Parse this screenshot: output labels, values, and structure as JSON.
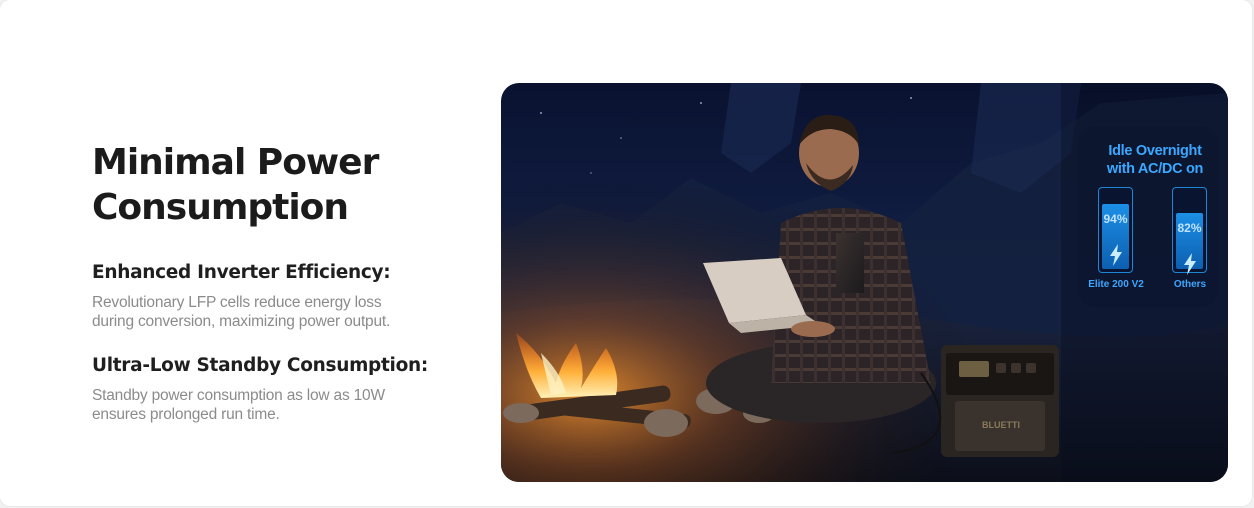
{
  "heading": {
    "line1": "Minimal Power",
    "line2": "Consumption"
  },
  "features": [
    {
      "title": "Enhanced Inverter Efficiency:",
      "line1": "Revolutionary LFP cells reduce energy loss",
      "line2": "during conversion, maximizing power output."
    },
    {
      "title": "Ultra-Low Standby Consumption:",
      "line1": "Standby power consumption as low as 10W",
      "line2": "ensures prolonged run time."
    }
  ],
  "comparison": {
    "title_line1": "Idle Overnight",
    "title_line2": "with AC/DC on",
    "accent_color": "#3aa8ff",
    "items": [
      {
        "percent": "94%",
        "level": 0.94,
        "label": "Elite 200 V2"
      },
      {
        "percent": "82%",
        "level": 0.82,
        "label": "Others"
      }
    ]
  },
  "photo": {
    "brand_text": "BLUETTI"
  }
}
